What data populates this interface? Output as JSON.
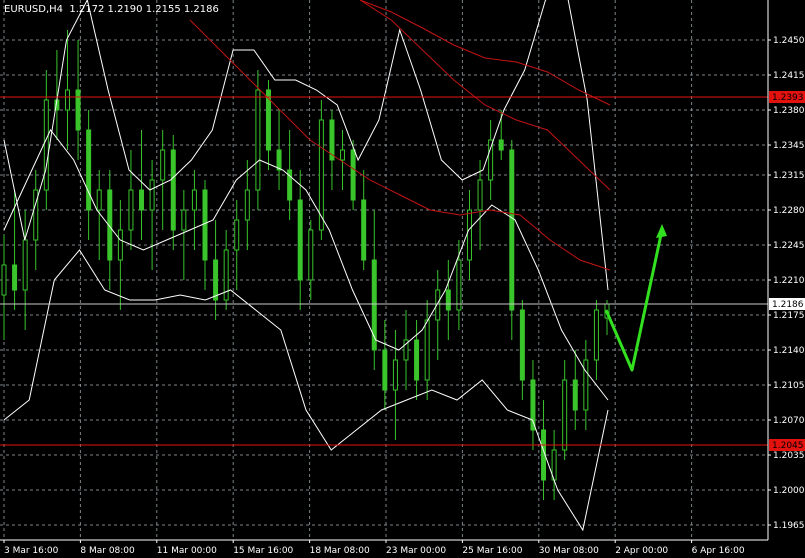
{
  "window": {
    "title": "EURUSD,H4  1.2172 1.2190 1.2155 1.2186"
  },
  "colors": {
    "background": "#000000",
    "grid": "#9aa4aa",
    "candle": "#39c52b",
    "band": "#ffffff",
    "ma": "#c21414",
    "level": "#e3120f",
    "arrow": "#33e01f",
    "text": "#ffffff"
  },
  "chart_data": {
    "type": "candlestick",
    "title": "EURUSD,H4",
    "ohlc_header": {
      "open": 1.2172,
      "high": 1.219,
      "low": 1.2155,
      "close": 1.2186
    },
    "ylim": [
      1.195,
      1.249
    ],
    "y_ticks": [
      "1.2450",
      "1.2415",
      "1.2380",
      "1.2345",
      "1.2315",
      "1.2280",
      "1.2245",
      "1.2210",
      "1.2175",
      "1.2140",
      "1.2105",
      "1.2070",
      "1.2035",
      "1.2000",
      "1.1965"
    ],
    "x_ticks": [
      "3 Mar 16:00",
      "8 Mar 08:00",
      "11 Mar 00:00",
      "15 Mar 16:00",
      "18 Mar 08:00",
      "23 Mar 00:00",
      "25 Mar 16:00",
      "30 Mar 08:00",
      "2 Apr 00:00",
      "6 Apr 16:00"
    ],
    "current_price": 1.2186,
    "horizontal_levels": [
      {
        "price": 1.2393,
        "label": "1.2393"
      },
      {
        "price": 1.2045,
        "label": "1.2045"
      }
    ],
    "series": [
      {
        "type": "candlestick",
        "values": [
          [
            1.2195,
            1.2255,
            1.215,
            1.2225
          ],
          [
            1.2225,
            1.23,
            1.218,
            1.22
          ],
          [
            1.22,
            1.228,
            1.216,
            1.225
          ],
          [
            1.225,
            1.232,
            1.222,
            1.23
          ],
          [
            1.23,
            1.242,
            1.228,
            1.239
          ],
          [
            1.239,
            1.244,
            1.235,
            1.238
          ],
          [
            1.238,
            1.246,
            1.234,
            1.24
          ],
          [
            1.24,
            1.245,
            1.233,
            1.236
          ],
          [
            1.236,
            1.238,
            1.225,
            1.228
          ],
          [
            1.228,
            1.232,
            1.223,
            1.23
          ],
          [
            1.23,
            1.232,
            1.22,
            1.223
          ],
          [
            1.223,
            1.229,
            1.218,
            1.226
          ],
          [
            1.226,
            1.234,
            1.224,
            1.23
          ],
          [
            1.23,
            1.236,
            1.225,
            1.228
          ],
          [
            1.228,
            1.233,
            1.222,
            1.231
          ],
          [
            1.231,
            1.236,
            1.226,
            1.234
          ],
          [
            1.234,
            1.2355,
            1.224,
            1.226
          ],
          [
            1.226,
            1.23,
            1.221,
            1.228
          ],
          [
            1.228,
            1.232,
            1.224,
            1.23
          ],
          [
            1.23,
            1.231,
            1.22,
            1.223
          ],
          [
            1.223,
            1.227,
            1.217,
            1.219
          ],
          [
            1.219,
            1.226,
            1.218,
            1.224
          ],
          [
            1.224,
            1.229,
            1.22,
            1.227
          ],
          [
            1.227,
            1.233,
            1.224,
            1.23
          ],
          [
            1.23,
            1.242,
            1.228,
            1.24
          ],
          [
            1.24,
            1.241,
            1.232,
            1.234
          ],
          [
            1.234,
            1.238,
            1.23,
            1.232
          ],
          [
            1.232,
            1.236,
            1.227,
            1.229
          ],
          [
            1.229,
            1.232,
            1.218,
            1.221
          ],
          [
            1.221,
            1.227,
            1.219,
            1.226
          ],
          [
            1.226,
            1.239,
            1.225,
            1.237
          ],
          [
            1.237,
            1.238,
            1.23,
            1.233
          ],
          [
            1.233,
            1.236,
            1.23,
            1.234
          ],
          [
            1.234,
            1.235,
            1.228,
            1.229
          ],
          [
            1.229,
            1.232,
            1.222,
            1.223
          ],
          [
            1.223,
            1.228,
            1.212,
            1.214
          ],
          [
            1.214,
            1.217,
            1.208,
            1.21
          ],
          [
            1.21,
            1.216,
            1.205,
            1.213
          ],
          [
            1.213,
            1.218,
            1.21,
            1.215
          ],
          [
            1.215,
            1.217,
            1.209,
            1.211
          ],
          [
            1.211,
            1.219,
            1.209,
            1.217
          ],
          [
            1.217,
            1.222,
            1.213,
            1.22
          ],
          [
            1.22,
            1.223,
            1.215,
            1.218
          ],
          [
            1.218,
            1.225,
            1.216,
            1.223
          ],
          [
            1.223,
            1.23,
            1.221,
            1.228
          ],
          [
            1.228,
            1.233,
            1.224,
            1.231
          ],
          [
            1.231,
            1.237,
            1.229,
            1.235
          ],
          [
            1.235,
            1.238,
            1.233,
            1.234
          ],
          [
            1.234,
            1.235,
            1.215,
            1.218
          ],
          [
            1.218,
            1.219,
            1.209,
            1.211
          ],
          [
            1.211,
            1.213,
            1.204,
            1.206
          ],
          [
            1.206,
            1.209,
            1.199,
            1.201
          ],
          [
            1.201,
            1.206,
            1.199,
            1.204
          ],
          [
            1.204,
            1.213,
            1.203,
            1.211
          ],
          [
            1.211,
            1.214,
            1.206,
            1.208
          ],
          [
            1.208,
            1.215,
            1.206,
            1.213
          ],
          [
            1.213,
            1.219,
            1.211,
            1.218
          ],
          [
            1.2172,
            1.219,
            1.2155,
            1.2186
          ]
        ]
      },
      {
        "name": "upper band",
        "type": "line",
        "values": [
          1.235,
          1.225,
          1.232,
          1.245,
          1.249,
          1.24,
          1.232,
          1.23,
          1.231,
          1.233,
          1.236,
          1.244,
          1.244,
          1.241,
          1.241,
          1.24,
          1.2385,
          1.233,
          1.237,
          1.246,
          1.24,
          1.233,
          1.231,
          1.232,
          1.238,
          1.242,
          1.249,
          1.25,
          1.239,
          1.22
        ]
      },
      {
        "name": "middle band",
        "type": "line",
        "values": [
          1.226,
          1.231,
          1.236,
          1.233,
          1.228,
          1.225,
          1.224,
          1.225,
          1.226,
          1.227,
          1.231,
          1.233,
          1.232,
          1.23,
          1.226,
          1.22,
          1.215,
          1.214,
          1.216,
          1.22,
          1.226,
          1.2285,
          1.227,
          1.222,
          1.216,
          1.212,
          1.209
        ]
      },
      {
        "name": "lower band",
        "type": "line",
        "values": [
          1.207,
          1.209,
          1.221,
          1.224,
          1.22,
          1.219,
          1.219,
          1.2195,
          1.219,
          1.22,
          1.218,
          1.216,
          1.208,
          1.204,
          1.206,
          1.208,
          1.209,
          1.21,
          1.209,
          1.211,
          1.208,
          1.207,
          1.2,
          1.196,
          1.208
        ]
      },
      {
        "name": "MA fast",
        "type": "line",
        "values": [
          1.247,
          1.244,
          1.241,
          1.238,
          1.235,
          1.233,
          1.231,
          1.2295,
          1.228,
          1.2275,
          1.228,
          1.2275,
          1.225,
          1.223,
          1.222
        ]
      },
      {
        "name": "MA medium",
        "type": "line",
        "values": [
          1.249,
          1.247,
          1.244,
          1.241,
          1.2385,
          1.237,
          1.236,
          1.233,
          1.23
        ]
      },
      {
        "name": "MA slow",
        "type": "line",
        "values": [
          1.249,
          1.2478,
          1.2462,
          1.2445,
          1.2432,
          1.2428,
          1.2418,
          1.24,
          1.2385
        ]
      }
    ],
    "forecast_arrow": [
      1.218,
      1.212,
      1.226
    ],
    "grid": true
  }
}
